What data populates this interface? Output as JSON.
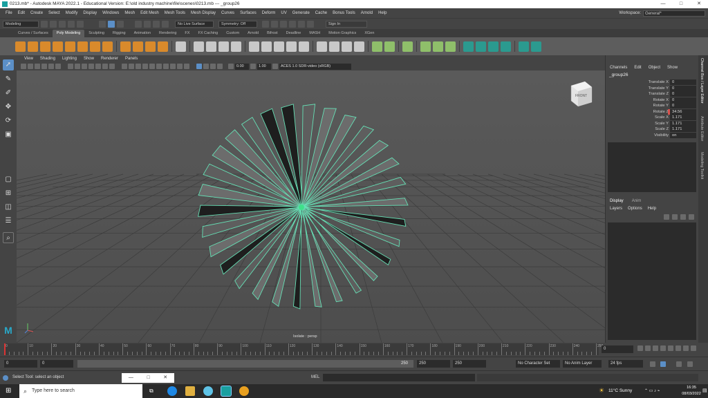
{
  "window": {
    "title": "0213.mb* - Autodesk MAYA 2022.1 - Educational Version: E:\\old industry machine\\file\\scenes\\0213.mb  ---  _group26",
    "minimize": "—",
    "maximize": "□",
    "close": "✕"
  },
  "menu": [
    "File",
    "Edit",
    "Create",
    "Select",
    "Modify",
    "Display",
    "Windows",
    "Mesh",
    "Edit Mesh",
    "Mesh Tools",
    "Mesh Display",
    "Curves",
    "Surfaces",
    "Deform",
    "UV",
    "Generate",
    "Cache",
    "Bonus Tools",
    "Arnold",
    "Help"
  ],
  "workspace": {
    "label": "Workspace:",
    "value": "General*"
  },
  "status": {
    "mode": "Modeling",
    "live_surface": "No Live Surface",
    "symmetry": "Symmetry: Off",
    "sign_in": "Sign In"
  },
  "shelf_tabs": [
    "Curves / Surfaces",
    "Poly Modeling",
    "Sculpting",
    "Rigging",
    "Animation",
    "Rendering",
    "FX",
    "FX Caching",
    "Custom",
    "Arnold",
    "Bifrost",
    "Deadline",
    "MASH",
    "Motion Graphics",
    "XGen"
  ],
  "shelf_active": "Poly Modeling",
  "panel_menu": [
    "View",
    "Shading",
    "Lighting",
    "Show",
    "Renderer",
    "Panels"
  ],
  "viewport": {
    "exposure": "0.00",
    "gamma": "1.00",
    "colorspace": "ACES 1.0 SDR-video (sRGB)",
    "camera_label": "Isolate : persp",
    "viewcube": "FRONT"
  },
  "channelbox": {
    "menu": [
      "Channels",
      "Edit",
      "Object",
      "Show"
    ],
    "object": "_group26",
    "attrs": [
      {
        "label": "Translate X",
        "value": "0"
      },
      {
        "label": "Translate Y",
        "value": "0"
      },
      {
        "label": "Translate Z",
        "value": "0"
      },
      {
        "label": "Rotate X",
        "value": "0"
      },
      {
        "label": "Rotate Y",
        "value": "0"
      },
      {
        "label": "Rotate Z",
        "value": "34.56"
      },
      {
        "label": "Scale X",
        "value": "1.171"
      },
      {
        "label": "Scale Y",
        "value": "1.171"
      },
      {
        "label": "Scale Z",
        "value": "1.171"
      },
      {
        "label": "Visibility",
        "value": "on"
      }
    ],
    "keyed_color": "#d9534f",
    "layer_tabs": [
      "Display",
      "Anim"
    ],
    "layer_menu": [
      "Layers",
      "Options",
      "Help"
    ]
  },
  "side_tabs": [
    "Channel Box / Layer Editor",
    "Attribute Editor",
    "Modeling Toolkit"
  ],
  "timeline": {
    "ticks": [
      "0",
      "10",
      "20",
      "30",
      "40",
      "50",
      "60",
      "70",
      "80",
      "90",
      "100",
      "110",
      "120",
      "130",
      "140",
      "150",
      "160",
      "170",
      "180",
      "190",
      "200",
      "210",
      "220",
      "230",
      "240",
      "250"
    ],
    "current": "0",
    "frame_field": "0"
  },
  "range": {
    "start": "0",
    "anim_start": "0",
    "range_end": "250",
    "end": "250",
    "anim_end": "250",
    "character_set": "No Character Set",
    "anim_layer": "No Anim Layer",
    "fps": "24 fps"
  },
  "help": {
    "text": "Select Tool: select an object",
    "mel": "MEL"
  },
  "taskbar": {
    "search": "Type here to search",
    "weather": "11°C  Sunny",
    "time": "16:35",
    "date": "08/03/2022"
  },
  "colors": {
    "accent": "#5fd3b3",
    "selected_edge": "#66e0b5",
    "active_tool": "#5b8fc7"
  }
}
